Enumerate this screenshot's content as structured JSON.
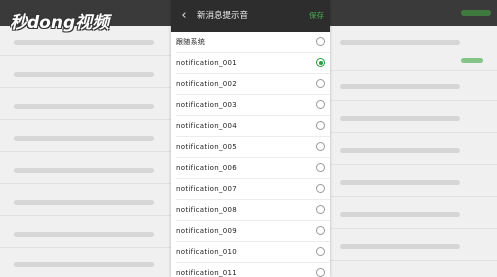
{
  "watermark": "秒dong视频",
  "header": {
    "back_glyph": "‹",
    "title": "新消息提示音",
    "save_label": "保存"
  },
  "sounds": [
    {
      "label": "跟随系统",
      "selected": false
    },
    {
      "label": "notification_001",
      "selected": true
    },
    {
      "label": "notification_002",
      "selected": false
    },
    {
      "label": "notification_003",
      "selected": false
    },
    {
      "label": "notification_004",
      "selected": false
    },
    {
      "label": "notification_005",
      "selected": false
    },
    {
      "label": "notification_006",
      "selected": false
    },
    {
      "label": "notification_007",
      "selected": false
    },
    {
      "label": "notification_008",
      "selected": false
    },
    {
      "label": "notification_009",
      "selected": false
    },
    {
      "label": "notification_010",
      "selected": false
    },
    {
      "label": "notification_011",
      "selected": false
    }
  ],
  "colors": {
    "accent": "#2e9b3e",
    "save_text": "#4caf50",
    "header_bg": "#2d2d2d"
  }
}
